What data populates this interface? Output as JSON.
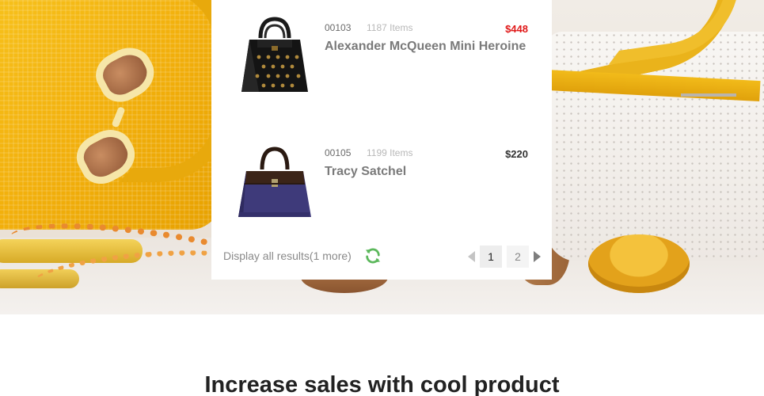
{
  "results": [
    {
      "code": "00103",
      "items": "1187 Items",
      "price": "$448",
      "price_style": "sale",
      "name": "Alexander McQueen Mini Heroine",
      "thumb_icon": "black-studded-handbag-image"
    },
    {
      "code": "00105",
      "items": "1199 Items",
      "price": "$220",
      "price_style": "regular",
      "name": "Tracy Satchel",
      "thumb_icon": "blue-satchel-image"
    }
  ],
  "footer": {
    "display_all": "Display all results(1 more)",
    "refresh_icon": "refresh-icon",
    "pages": [
      "1",
      "2"
    ],
    "current_page": "1"
  },
  "section": {
    "heading": "Increase sales with cool product"
  },
  "colors": {
    "sale_price": "#e01818",
    "refresh_green": "#5cb85c",
    "accent_yellow": "#f2b00c"
  }
}
